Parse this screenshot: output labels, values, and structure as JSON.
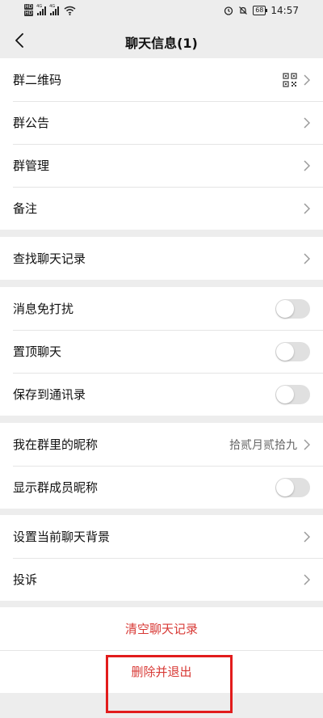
{
  "status_bar": {
    "hd1": "HD",
    "hd2": "HD",
    "net1": "4G",
    "net2": "4G",
    "battery": "68",
    "time": "14:57"
  },
  "header": {
    "title": "聊天信息(1)"
  },
  "group_info": {
    "qr_label": "群二维码",
    "announcement_label": "群公告",
    "manage_label": "群管理",
    "remark_label": "备注"
  },
  "search": {
    "history_label": "查找聊天记录"
  },
  "settings": {
    "mute_label": "消息免打扰",
    "mute_on": false,
    "pin_label": "置顶聊天",
    "pin_on": false,
    "save_contacts_label": "保存到通讯录",
    "save_contacts_on": false
  },
  "nickname": {
    "my_nickname_label": "我在群里的昵称",
    "my_nickname_value": "拾贰月贰拾九",
    "show_nickname_label": "显示群成员昵称",
    "show_nickname_on": false
  },
  "misc": {
    "background_label": "设置当前聊天背景",
    "complaint_label": "投诉"
  },
  "actions": {
    "clear_history": "清空聊天记录",
    "delete_exit": "删除并退出"
  },
  "colors": {
    "accent_red": "#d83a36",
    "highlight_red": "#e21c1c",
    "background": "#ededed"
  }
}
